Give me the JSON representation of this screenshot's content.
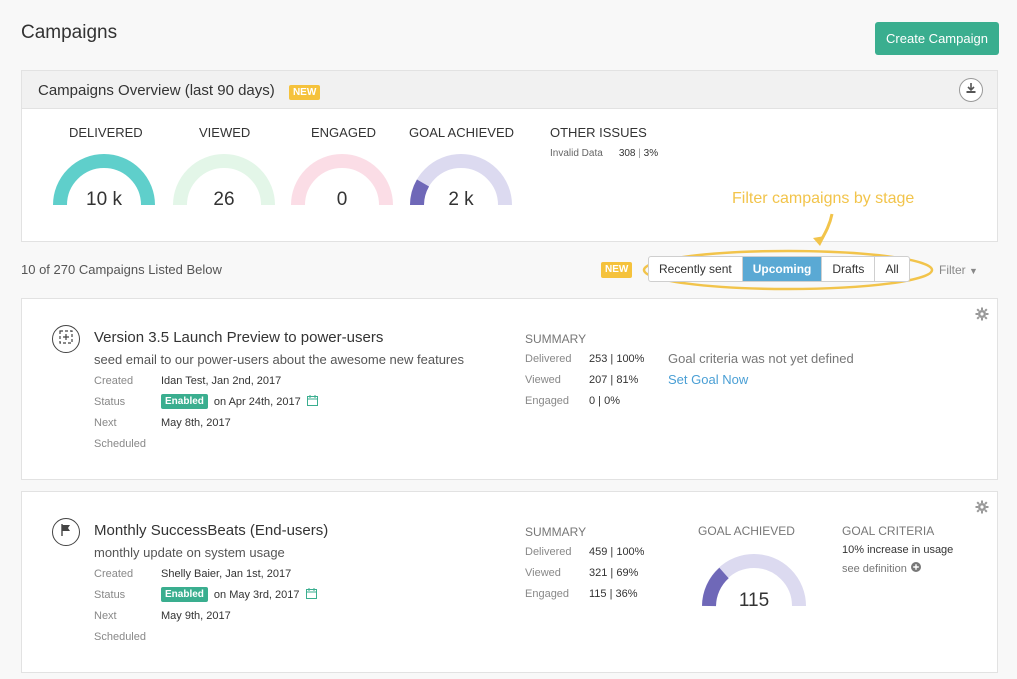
{
  "page": {
    "title": "Campaigns",
    "create_button": "Create Campaign"
  },
  "overview": {
    "title": "Campaigns Overview (last 90 days)",
    "badge": "NEW",
    "metrics": [
      {
        "label": "DELIVERED",
        "value": "10 k",
        "color": "#5fcfcb",
        "track": "#d8f3f2",
        "fill": 1.0
      },
      {
        "label": "VIEWED",
        "value": "26",
        "color": "#e3f6e8",
        "track": "#e3f6e8",
        "fill": 0.0
      },
      {
        "label": "ENGAGED",
        "value": "0",
        "color": "#fbdde6",
        "track": "#fbdde6",
        "fill": 0.0
      },
      {
        "label": "GOAL ACHIEVED",
        "value": "2 k",
        "color": "#6f68b8",
        "track": "#dcdaf0",
        "fill": 0.12
      }
    ],
    "other": {
      "title": "OTHER ISSUES",
      "label": "Invalid Data",
      "count": "308",
      "pct": "3%"
    }
  },
  "annotation": "Filter campaigns by stage",
  "list": {
    "count_text": "10 of 270 Campaigns Listed Below",
    "badge": "NEW",
    "tabs": [
      "Recently sent",
      "Upcoming",
      "Drafts",
      "All"
    ],
    "active_tab": "Upcoming",
    "filter_label": "Filter"
  },
  "campaigns": [
    {
      "title": "Version 3.5 Launch Preview to power-users",
      "description": "seed email to our power-users about the awesome new features",
      "created_label": "Created",
      "created": "Idan Test, Jan 2nd, 2017",
      "status_label": "Status",
      "status": "Enabled",
      "status_date": "on Apr 24th, 2017",
      "next_label": "Next",
      "scheduled_label": "Scheduled",
      "next": "May 8th, 2017",
      "summary_title": "SUMMARY",
      "summary": [
        {
          "label": "Delivered",
          "value": "253 | 100%"
        },
        {
          "label": "Viewed",
          "value": "207 | 81%"
        },
        {
          "label": "Engaged",
          "value": "0 | 0%"
        }
      ],
      "goal_note": "Goal criteria was not yet defined",
      "goal_link": "Set Goal Now"
    },
    {
      "title": "Monthly SuccessBeats (End-users)",
      "description": "monthly update on system usage",
      "created_label": "Created",
      "created": "Shelly Baier, Jan 1st, 2017",
      "status_label": "Status",
      "status": "Enabled",
      "status_date": "on May 3rd, 2017",
      "next_label": "Next",
      "scheduled_label": "Scheduled",
      "next": "May 9th, 2017",
      "summary_title": "SUMMARY",
      "summary": [
        {
          "label": "Delivered",
          "value": "459 | 100%"
        },
        {
          "label": "Viewed",
          "value": "321 | 69%"
        },
        {
          "label": "Engaged",
          "value": "115 | 36%"
        }
      ],
      "goal_achieved_title": "GOAL ACHIEVED",
      "goal_achieved_value": "115",
      "goal_fill": 0.22,
      "goal_criteria_title": "GOAL CRITERIA",
      "goal_criteria": "10% increase in usage",
      "see_definition": "see definition"
    }
  ],
  "colors": {
    "accent": "#3aae8f",
    "tab_active": "#5aa9d4",
    "badge": "#f5c23c",
    "annotation": "#f2c44b",
    "link": "#4a9fd5"
  }
}
